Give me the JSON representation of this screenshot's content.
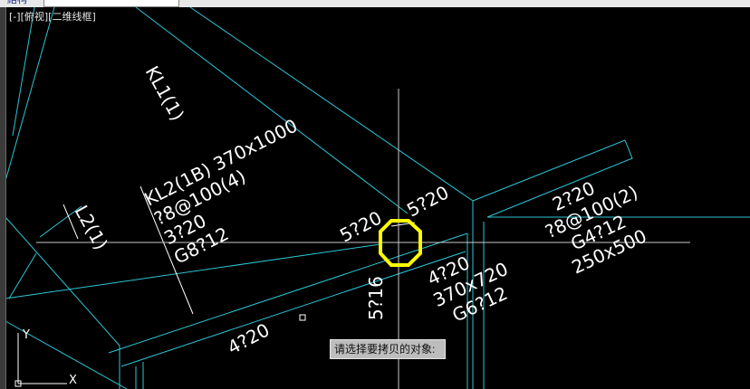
{
  "window": {
    "tab_left": "結构",
    "tab_right": ""
  },
  "viewport": {
    "control_minus": "[-]",
    "view_name": "[俯视]",
    "visual_style": "[二维线框]"
  },
  "annotations": {
    "kl1": "KL1(1)",
    "kl2_line1": "KL2(1B) 370x1000",
    "kl2_line2": "?8@100(4)",
    "kl2_line3": "3?20",
    "kl2_line4": "G8?12",
    "l2": "L2(1)",
    "top_left_bar": "5?20",
    "top_right_bar": "5?20",
    "right_line1": "2?20",
    "right_line2": "?8@100(2)",
    "right_line3": "G4?12",
    "right_line4": "250x500",
    "center_line1": "4?20",
    "center_line2": "370x720",
    "center_line3": "G6?12",
    "vertical_bar": "5?16",
    "bottom_bar": "4?20"
  },
  "ucs": {
    "y_label": "Y",
    "x_label": "X"
  },
  "command": {
    "prompt": "请选择要拷贝的对象:"
  },
  "colors": {
    "background": "#000000",
    "cyan_lines": "#2cc6d6",
    "crosshair": "#c8c8c8",
    "highlight": "#ffff00",
    "text": "#ffffff"
  }
}
